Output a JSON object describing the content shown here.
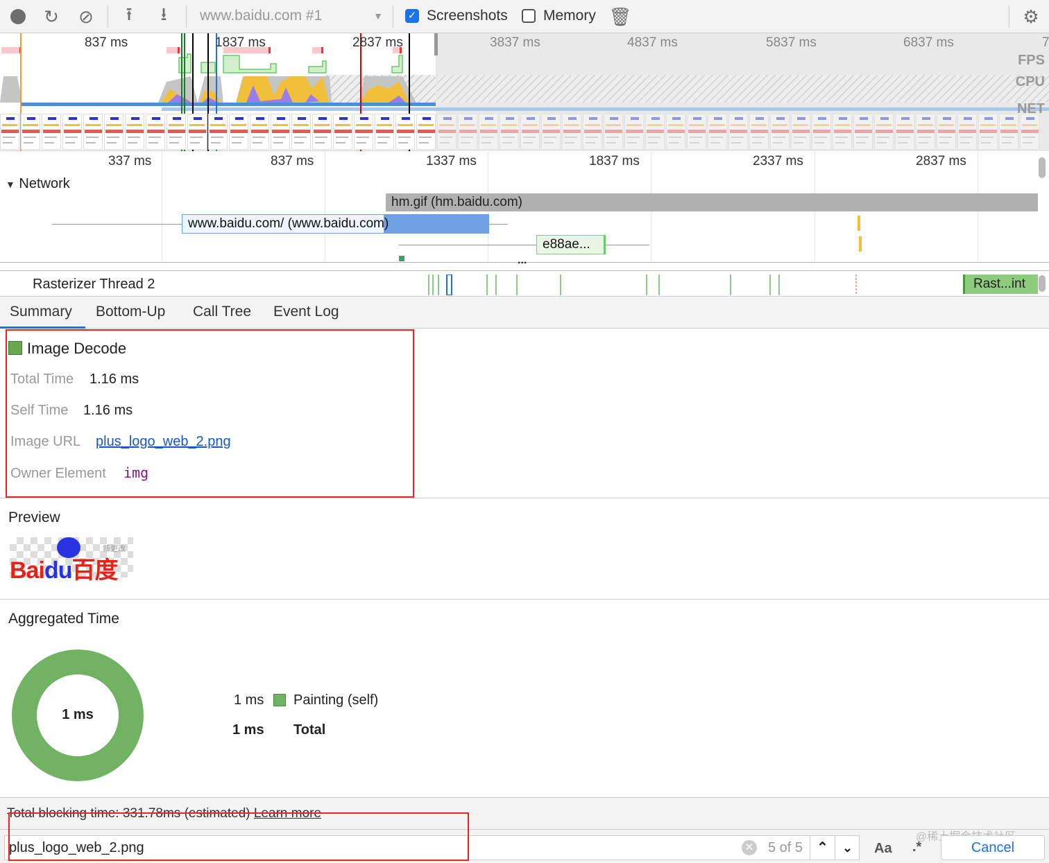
{
  "toolbar": {
    "record_icon": "record-icon",
    "reload_icon": "reload-icon",
    "clear_icon": "clear-icon",
    "upload_icon": "upload-icon",
    "download_icon": "download-icon",
    "profile_select": "www.baidu.com #1",
    "screenshots_label": "Screenshots",
    "screenshots_checked": true,
    "memory_label": "Memory",
    "memory_checked": false
  },
  "overview": {
    "time_labels": [
      "837 ms",
      "1837 ms",
      "2837 ms",
      "3837 ms",
      "4837 ms",
      "5837 ms",
      "6837 ms",
      "7"
    ],
    "tracks": [
      "FPS",
      "CPU",
      "NET"
    ]
  },
  "ruler": {
    "labels": [
      "337 ms",
      "837 ms",
      "1337 ms",
      "1837 ms",
      "2337 ms",
      "2837 ms"
    ]
  },
  "network": {
    "title": "Network",
    "requests": [
      "hm.gif (hm.baidu.com)",
      "www.baidu.com/ (www.baidu.com)",
      "e88ae..."
    ],
    "more": "..."
  },
  "raster": {
    "title": "Rasterizer Thread 2",
    "event": "Rast...int"
  },
  "tabs": [
    "Summary",
    "Bottom-Up",
    "Call Tree",
    "Event Log"
  ],
  "summary": {
    "event_title": "Image Decode",
    "event_color": "#6aa84f",
    "rows": [
      {
        "label": "Total Time",
        "value": "1.16 ms"
      },
      {
        "label": "Self Time",
        "value": "1.16 ms"
      },
      {
        "label": "Image URL",
        "value": "plus_logo_web_2.png"
      },
      {
        "label": "Owner Element",
        "value": "img"
      }
    ]
  },
  "preview": {
    "title": "Preview",
    "logo_text": "Bai du 百度",
    "logo_small": "新更改"
  },
  "aggregated": {
    "title": "Aggregated Time",
    "center": "1 ms",
    "legend": [
      {
        "value": "1 ms",
        "label": "Painting (self)",
        "color": "#71b363"
      }
    ],
    "total_value": "1 ms",
    "total_label": "Total"
  },
  "footer": {
    "text": "Total blocking time: 331.78ms (estimated)",
    "link": "Learn more"
  },
  "search": {
    "value": "plus_logo_web_2.png",
    "count": "5 of 5",
    "case_label": "Aa",
    "regex_label": ".*",
    "cancel": "Cancel",
    "watermark": "@稀土掘金技术社区"
  }
}
